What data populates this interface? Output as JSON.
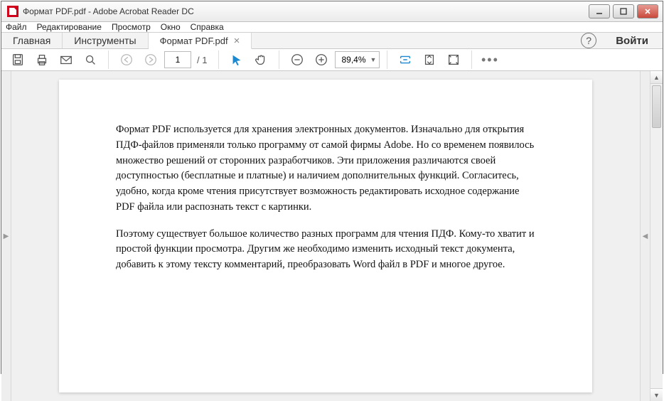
{
  "titlebar": {
    "title": "Формат PDF.pdf - Adobe Acrobat Reader DC"
  },
  "menubar": [
    "Файл",
    "Редактирование",
    "Просмотр",
    "Окно",
    "Справка"
  ],
  "tabs": {
    "home": "Главная",
    "tools": "Инструменты",
    "file": "Формат PDF.pdf",
    "signin": "Войти"
  },
  "toolbar": {
    "page_current": "1",
    "page_total": "/ 1",
    "zoom": "89,4%"
  },
  "document": {
    "para1": "Формат PDF используется для хранения электронных документов. Изначально для открытия ПДФ-файлов применяли только программу от самой фирмы Adobe. Но со временем появилось множество решений от сторонних разработчиков. Эти приложения различаются своей доступностью (бесплатные и платные) и наличием дополнительных функций. Согласитесь, удобно, когда кроме чтения присутствует возможность редактировать исходное содержание PDF файла или распознать текст с картинки.",
    "para2": "Поэтому существует большое количество разных программ для чтения ПДФ. Кому-то хватит и простой функции просмотра. Другим же необходимо изменить исходный текст документа, добавить к этому тексту комментарий, преобразовать Word файл в PDF и многое другое."
  }
}
